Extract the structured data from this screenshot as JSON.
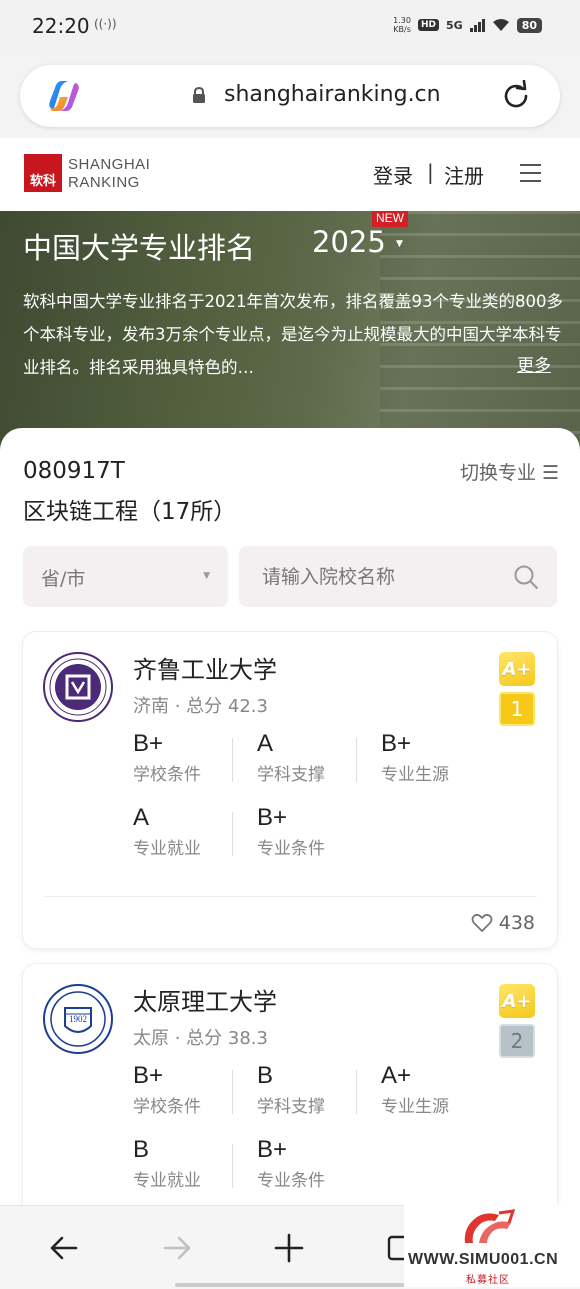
{
  "status_bar": {
    "time": "22:20",
    "speed": "1.30\nKB/s",
    "hd": "HD",
    "network": "5G",
    "battery": "80"
  },
  "browser": {
    "url": "shanghairanking.cn"
  },
  "site_header": {
    "logo_cn": "软科",
    "logo_line1": "SHANGHAI",
    "logo_line2": "RANKING",
    "login": "登录",
    "separator": "|",
    "register": "注册"
  },
  "hero": {
    "title": "中国大学专业排名",
    "year": "2025",
    "new_badge": "NEW",
    "description": "软科中国大学专业排名于2021年首次发布，排名覆盖93个专业类的800多个本科专业，发布3万余个专业点，是迄今为止规模最大的中国大学本科专业排名。排名采用独具特色的…",
    "more": "更多"
  },
  "major": {
    "code": "080917T",
    "name": "区块链工程（17所）",
    "switch_label": "切换专业 ☰"
  },
  "filters": {
    "province_placeholder": "省/市",
    "search_placeholder": "请输入院校名称"
  },
  "schools": [
    {
      "name": "齐鲁工业大学",
      "meta": "济南 · 总分 42.3",
      "grade": "A+",
      "rank": "1",
      "scores": [
        {
          "value": "B+",
          "label": "学校条件"
        },
        {
          "value": "A",
          "label": "学科支撑"
        },
        {
          "value": "B+",
          "label": "专业生源"
        },
        {
          "value": "A",
          "label": "专业就业"
        },
        {
          "value": "B+",
          "label": "专业条件"
        }
      ],
      "likes": "438"
    },
    {
      "name": "太原理工大学",
      "meta": "太原 · 总分 38.3",
      "grade": "A+",
      "rank": "2",
      "scores": [
        {
          "value": "B+",
          "label": "学校条件"
        },
        {
          "value": "B",
          "label": "学科支撑"
        },
        {
          "value": "A+",
          "label": "专业生源"
        },
        {
          "value": "B",
          "label": "专业就业"
        },
        {
          "value": "B+",
          "label": "专业条件"
        }
      ]
    }
  ],
  "watermark": {
    "text": "WWW.SIMU001.CN",
    "sub": "私募社区"
  },
  "colors": {
    "brand_red": "#c8161e",
    "grade_gold": "#f5c81a",
    "rank_silver": "#b7c2c8"
  }
}
